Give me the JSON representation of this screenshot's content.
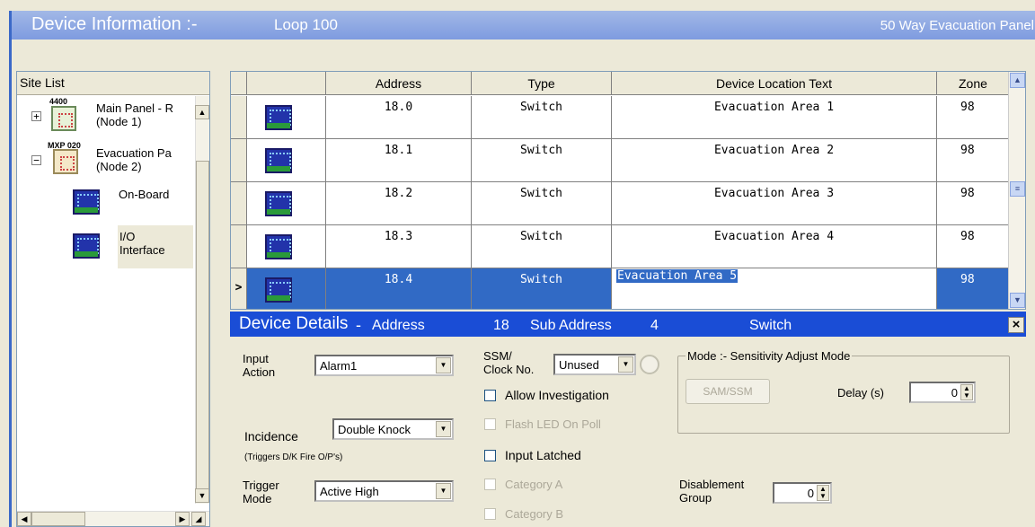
{
  "title": {
    "main": "Device Information :-",
    "loop": "Loop 100",
    "panel": "50 Way Evacuation Panel"
  },
  "site_list": {
    "header": "Site List",
    "nodes": [
      {
        "tag": "4400",
        "name": "Main Panel - R",
        "sub": "(Node 1)",
        "expander": "+"
      },
      {
        "tag": "MXP 020",
        "name": "Evacuation Pa",
        "sub": "(Node 2)",
        "expander": "−"
      }
    ],
    "children": [
      {
        "name": "On-Board",
        "sub": ""
      },
      {
        "name": "I/O",
        "sub": "Interface"
      }
    ]
  },
  "grid": {
    "columns": [
      "Address",
      "Type",
      "Device Location Text",
      "Zone"
    ],
    "rows": [
      {
        "address": "18.0",
        "type": "Switch",
        "location": "Evacuation Area 1",
        "zone": "98",
        "selected": false
      },
      {
        "address": "18.1",
        "type": "Switch",
        "location": "Evacuation Area 2",
        "zone": "98",
        "selected": false
      },
      {
        "address": "18.2",
        "type": "Switch",
        "location": "Evacuation Area 3",
        "zone": "98",
        "selected": false
      },
      {
        "address": "18.3",
        "type": "Switch",
        "location": "Evacuation Area 4",
        "zone": "98",
        "selected": false
      },
      {
        "address": "18.4",
        "type": "Switch",
        "location": "Evacuation Area 5",
        "zone": "98",
        "selected": true
      }
    ],
    "row_pointer": ">"
  },
  "details": {
    "title": "Device Details",
    "dash": "-",
    "address_label": "Address",
    "address_value": "18",
    "sub_address_label": "Sub Address",
    "sub_address_value": "4",
    "type_value": "Switch",
    "close": "×",
    "input_action_label1": "Input",
    "input_action_label2": "Action",
    "input_action_value": "Alarm1",
    "ssm_label1": "SSM/",
    "ssm_label2": "Clock No.",
    "ssm_value": "Unused",
    "allow_investigation": "Allow Investigation",
    "flash_led": "Flash LED On Poll",
    "input_latched": "Input Latched",
    "category_a": "Category A",
    "category_b": "Category B",
    "incidence_label": "Incidence",
    "incidence_value": "Double Knock",
    "incidence_note": "(Triggers D/K Fire O/P's)",
    "trigger_label1": "Trigger",
    "trigger_label2": "Mode",
    "trigger_value": "Active High",
    "mode_group": "Mode :- Sensitivity Adjust Mode",
    "sam_ssm": "SAM/SSM",
    "delay_label": "Delay (s)",
    "delay_value": "0",
    "disablement_label1": "Disablement",
    "disablement_label2": "Group",
    "disablement_value": "0"
  },
  "colors": {
    "title_bar": "#7e9be0",
    "details_bar": "#1a4dd6",
    "selection": "#316ac5"
  }
}
